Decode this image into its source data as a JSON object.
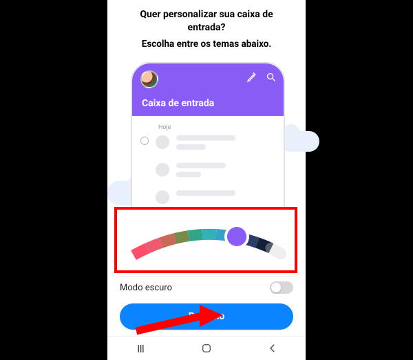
{
  "title_line1": "Quer personalizar sua caixa de",
  "title_line2": "entrada?",
  "subtitle": "Escolha entre os temas abaixo.",
  "preview": {
    "inbox_title": "Caixa de entrada",
    "day_label": "Hoje"
  },
  "theme_slider": {
    "segments": [
      "#ff4d6a",
      "#f05a6e",
      "#c96a56",
      "#7a8a4a",
      "#2fa68a",
      "#31b1b8",
      "#36a0c9",
      "#8a5cf6",
      "#2d3e66",
      "#12203a",
      "#ffffff"
    ],
    "selected_color": "#8a5cf6"
  },
  "dark_mode": {
    "label": "Modo escuro",
    "enabled": false
  },
  "primary_button": "Próximo",
  "colors": {
    "accent": "#8a5cf6",
    "primary_button": "#0b84ff",
    "highlight": "#ff0000"
  }
}
